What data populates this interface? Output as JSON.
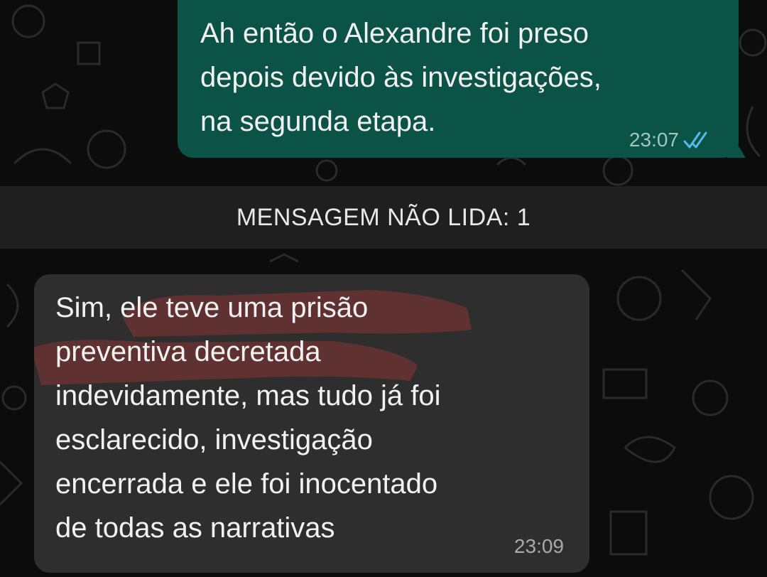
{
  "conversation": {
    "messages": [
      {
        "direction": "outgoing",
        "text": "Ah então o Alexandre foi preso\ndepois devido às investigações,\nna segunda etapa.",
        "time": "23:07",
        "status_icon": "double-check-icon",
        "bubble_color": "#0b5346"
      },
      {
        "direction": "incoming",
        "text": "Sim, ele teve uma prisão\npreventiva decretada\nindevidamente, mas tudo já foi\nesclarecido, investigação\nencerrada e ele foi inocentado\nde todas as narrativas",
        "time": "23:09",
        "bubble_color": "#2e2e2e"
      }
    ],
    "unread_divider": "MENSAGEM NÃO LIDA: 1"
  },
  "colors": {
    "background": "#0c0c0c",
    "read_check": "#53bdeb",
    "highlight_mark": "#8a3434"
  }
}
